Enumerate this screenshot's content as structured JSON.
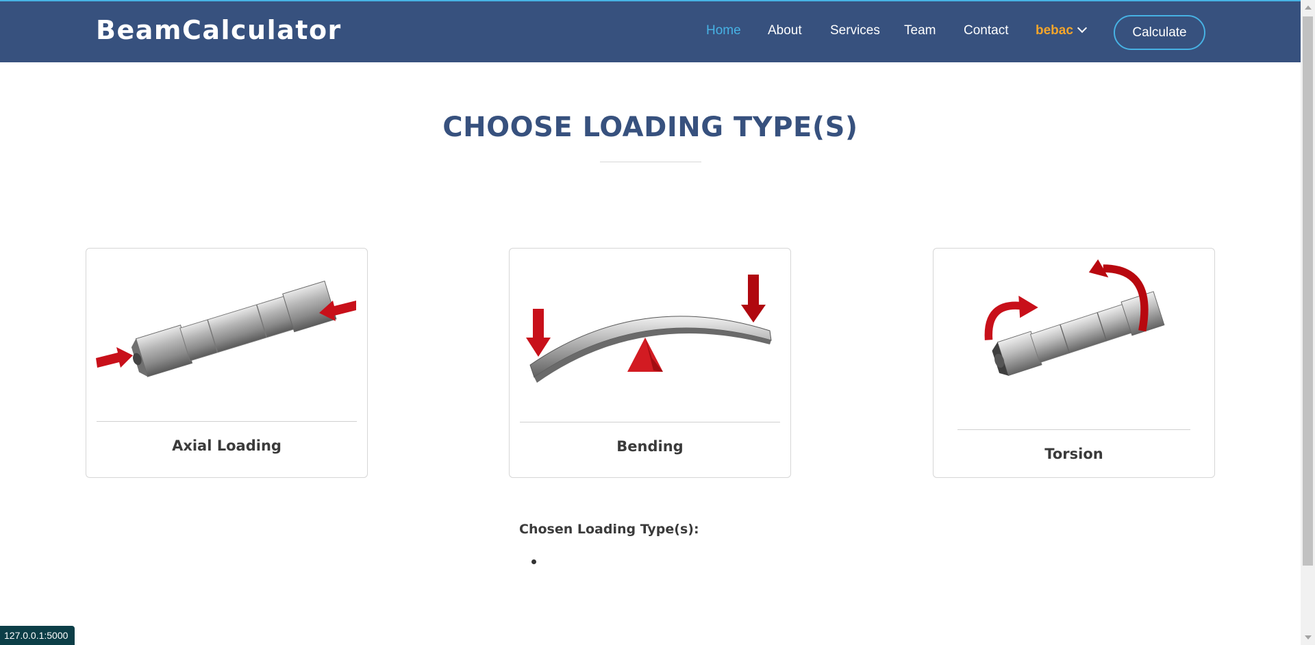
{
  "header": {
    "logo": "BeamCalculator",
    "nav": [
      {
        "label": "Home"
      },
      {
        "label": "About"
      },
      {
        "label": "Services"
      },
      {
        "label": "Team"
      },
      {
        "label": "Contact"
      }
    ],
    "user_label": "bebac",
    "cta_label": "Calculate"
  },
  "main": {
    "title": "CHOOSE LOADING TYPE(S)",
    "cards": [
      {
        "label": "Axial Loading",
        "icon": "axial-loading-illustration"
      },
      {
        "label": "Bending",
        "icon": "bending-illustration"
      },
      {
        "label": "Torsion",
        "icon": "torsion-illustration"
      }
    ],
    "chosen_title": "Chosen Loading Type(s):",
    "chosen_items": [
      ""
    ]
  },
  "status_bar": {
    "url": "127.0.0.1:5000"
  },
  "colors": {
    "header_bg": "#37517e",
    "accent": "#47b2e4",
    "user_accent": "#f4a52b",
    "arrow_red": "#c8101a"
  }
}
